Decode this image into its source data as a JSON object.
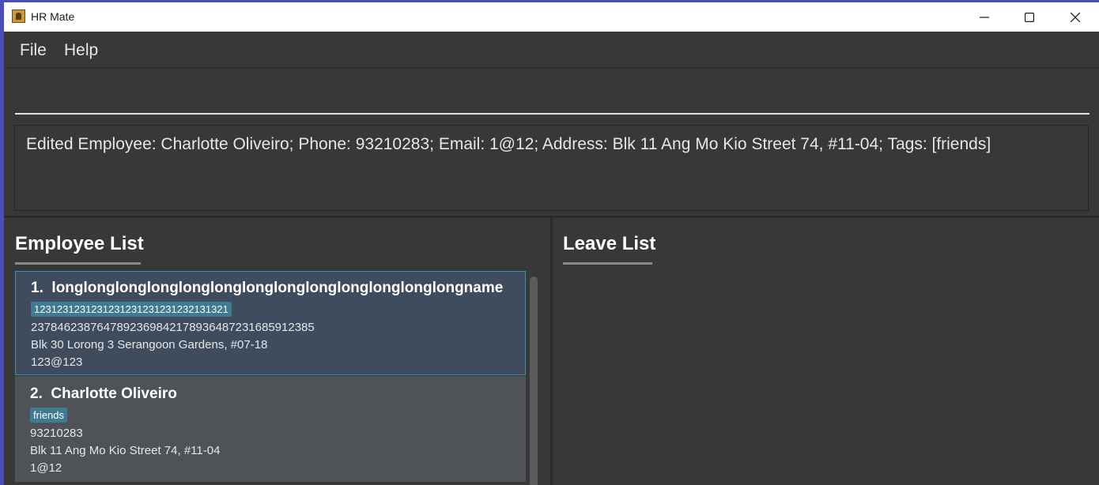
{
  "window": {
    "title": "HR Mate",
    "icon": "contact-book-icon"
  },
  "menu": {
    "file_label": "File",
    "help_label": "Help"
  },
  "command": {
    "value": "",
    "placeholder": ""
  },
  "result": {
    "text": "Edited Employee: Charlotte Oliveiro; Phone: 93210283; Email: 1@12; Address: Blk 11 Ang Mo Kio Street 74, #11-04; Tags: [friends]"
  },
  "employee_list": {
    "title": "Employee List",
    "items": [
      {
        "index": "1.",
        "name": "longlonglonglonglonglonglonglonglonglonglonglonglongname",
        "tags": [
          "1231231231231231231231231232131321"
        ],
        "phone": "2378462387647892369842178936487231685912385",
        "address": "Blk 30 Lorong 3 Serangoon Gardens, #07-18",
        "email": "123@123",
        "selected": true
      },
      {
        "index": "2.",
        "name": "Charlotte Oliveiro",
        "tags": [
          "friends"
        ],
        "phone": "93210283",
        "address": "Blk 11 Ang Mo Kio Street 74, #11-04",
        "email": "1@12",
        "selected": false
      }
    ]
  },
  "leave_list": {
    "title": "Leave List",
    "items": []
  },
  "colors": {
    "background": "#383838",
    "selected_card": "#3f4c5e",
    "selected_border": "#3d8fb0",
    "card": "#4f5357",
    "tag": "#3e7b91"
  }
}
